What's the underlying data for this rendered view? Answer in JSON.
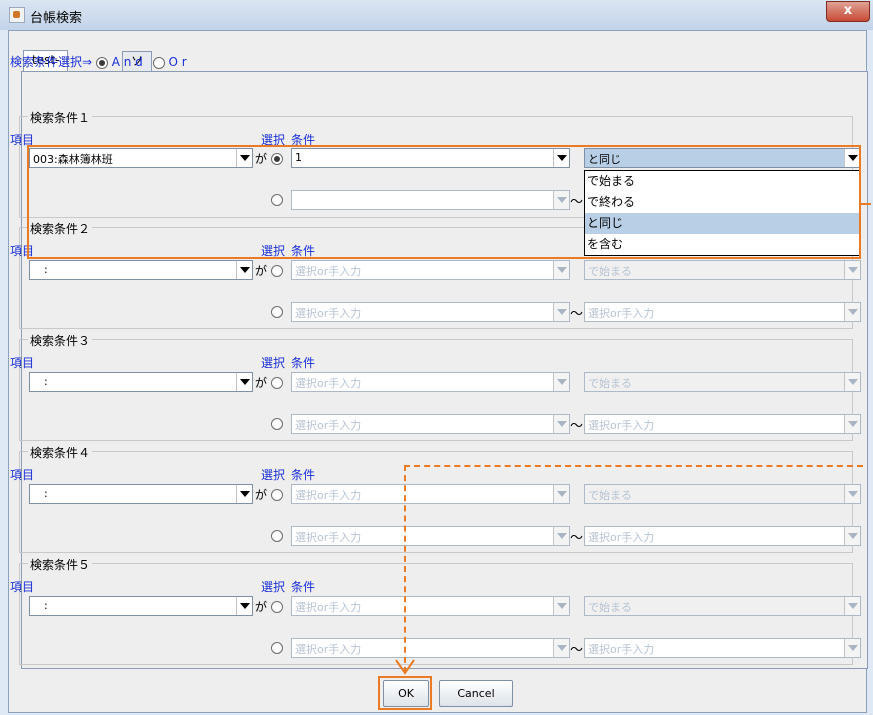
{
  "window": {
    "title": "台帳検索",
    "close_label": "x"
  },
  "tabs": [
    {
      "label": "test-森林簿"
    },
    {
      "label": "ソート順"
    }
  ],
  "combine": {
    "label": "検索条件選択⇒",
    "and_label": "A n d",
    "or_label": "O r"
  },
  "groups": [
    {
      "title": "検索条件１",
      "item_label": "項目",
      "select_label": "選択",
      "cond_label": "条件",
      "ga": "が",
      "item_value": "003:森林簿林班",
      "value1": "1",
      "op": "と同じ",
      "value2": "",
      "tilde": "～"
    },
    {
      "title": "検索条件２",
      "item_label": "項目",
      "select_label": "選択",
      "cond_label": "条件",
      "ga": "が",
      "item_value": ":",
      "value1": "選択or手入力",
      "op": "で始まる",
      "value2": "選択or手入力",
      "tilde": "～"
    },
    {
      "title": "検索条件３",
      "item_label": "項目",
      "select_label": "選択",
      "cond_label": "条件",
      "ga": "が",
      "item_value": ":",
      "value1": "選択or手入力",
      "op": "で始まる",
      "value2": "選択or手入力",
      "tilde": "～"
    },
    {
      "title": "検索条件４",
      "item_label": "項目",
      "select_label": "選択",
      "cond_label": "条件",
      "ga": "が",
      "item_value": ":",
      "value1": "選択or手入力",
      "op": "で始まる",
      "value2": "選択or手入力",
      "tilde": "～"
    },
    {
      "title": "検索条件５",
      "item_label": "項目",
      "select_label": "選択",
      "cond_label": "条件",
      "ga": "が",
      "item_value": ":",
      "value1": "選択or手入力",
      "op": "で始まる",
      "value2": "選択or手入力",
      "tilde": "～"
    }
  ],
  "op_dropdown": {
    "options": [
      "で始まる",
      "で終わる",
      "と同じ",
      "を含む"
    ],
    "selected": "と同じ"
  },
  "buttons": {
    "ok": "OK",
    "cancel": "Cancel"
  },
  "colors": {
    "highlight": "#ea7a23",
    "label_blue": "#1a2fd6",
    "selection": "#b8cfe6"
  }
}
